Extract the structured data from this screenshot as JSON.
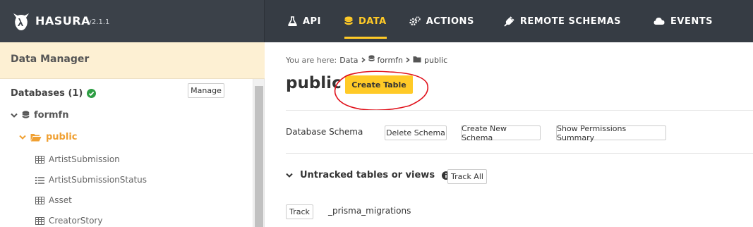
{
  "brand": {
    "name": "HASURA",
    "version": "v2.1.1"
  },
  "nav": [
    {
      "label": "API",
      "icon": "flask-icon"
    },
    {
      "label": "DATA",
      "icon": "database-icon",
      "active": true
    },
    {
      "label": "ACTIONS",
      "icon": "cogs-icon"
    },
    {
      "label": "REMOTE SCHEMAS",
      "icon": "plug-icon"
    },
    {
      "label": "EVENTS",
      "icon": "cloud-icon"
    }
  ],
  "colors": {
    "accent": "#ffca27",
    "topbar": "#363c44",
    "sidebar_header": "#fdf0d3",
    "schema_active": "#f0a032",
    "ok": "#2e9e44",
    "annotation": "#e0101a"
  },
  "sidebar": {
    "header": "Data Manager",
    "databases_label": "Databases (1)",
    "manage_label": "Manage",
    "database": "formfn",
    "schema": "public",
    "tables": [
      {
        "name": "ArtistSubmission",
        "icon": "table-icon"
      },
      {
        "name": "ArtistSubmissionStatus",
        "icon": "enum-list-icon"
      },
      {
        "name": "Asset",
        "icon": "table-icon"
      },
      {
        "name": "CreatorStory",
        "icon": "table-icon"
      }
    ]
  },
  "main": {
    "breadcrumb": {
      "prefix": "You are here:",
      "data": "Data",
      "database": "formfn",
      "schema": "public"
    },
    "title": "public",
    "create_table_label": "Create Table",
    "schema_label": "Database Schema",
    "delete_schema_label": "Delete Schema",
    "create_schema_label": "Create New Schema",
    "permissions_summary_label": "Show Permissions Summary",
    "untracked_title": "Untracked tables or views",
    "track_all_label": "Track All",
    "track_label": "Track",
    "untracked_table": "_prisma_migrations"
  }
}
